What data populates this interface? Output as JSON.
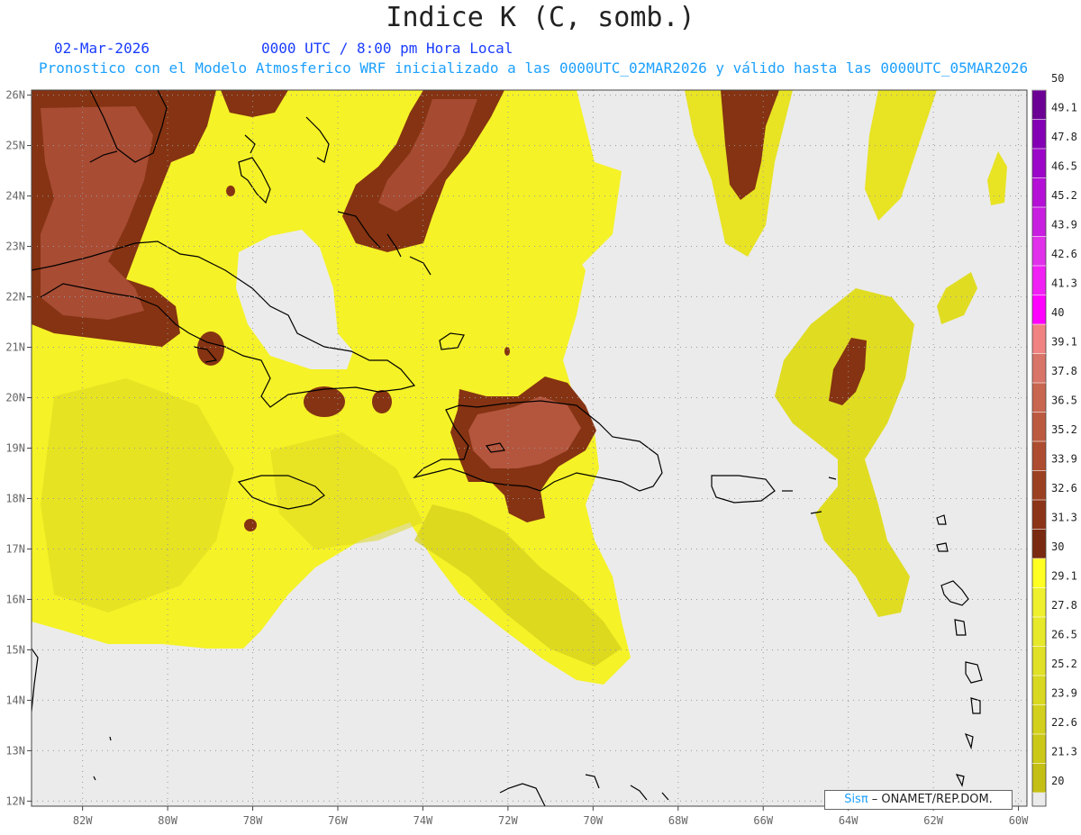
{
  "header": {
    "title": "Indice K (C, somb.)",
    "date": "02-Mar-2026",
    "time": "0000 UTC / 8:00 pm Hora Local",
    "description": "Pronostico con el Modelo Atmosferico WRF inicializado a las 0000UTC_02MAR2026 y válido hasta las  0000UTC_05MAR2026"
  },
  "map": {
    "lon_range": [
      -83.2,
      -59.8
    ],
    "lat_range": [
      11.9,
      26.1
    ],
    "lon_ticks": [
      "82W",
      "80W",
      "78W",
      "76W",
      "74W",
      "72W",
      "70W",
      "68W",
      "66W",
      "64W",
      "62W",
      "60W"
    ],
    "lat_ticks": [
      "12N",
      "13N",
      "14N",
      "15N",
      "16N",
      "17N",
      "18N",
      "19N",
      "20N",
      "21N",
      "22N",
      "23N",
      "24N",
      "25N",
      "26N"
    ],
    "grid": true,
    "background_color": "#ebebeb"
  },
  "colorbar": {
    "labels": [
      "20",
      "21.3",
      "22.6",
      "23.9",
      "25.2",
      "26.5",
      "27.8",
      "29.1",
      "30",
      "31.3",
      "32.6",
      "33.9",
      "35.2",
      "36.5",
      "37.8",
      "39.1",
      "40",
      "41.3",
      "42.6",
      "43.9",
      "45.2",
      "46.5",
      "47.8",
      "49.1",
      "50"
    ],
    "colors": [
      "#c4bf14",
      "#cbc818",
      "#d2d01c",
      "#d9d821",
      "#e0e026",
      "#e6e82a",
      "#eef02e",
      "#ffff22",
      "#7a2a10",
      "#8c3418",
      "#9c4022",
      "#ad4c30",
      "#bc5a40",
      "#c86650",
      "#d87468",
      "#f08282",
      "#ff00ff",
      "#f020f4",
      "#e030ea",
      "#c81ee0",
      "#b410d6",
      "#9c06c8",
      "#8400b4",
      "#6c0094",
      "#620070"
    ]
  },
  "credit": {
    "brand": "Sisπ",
    "text": " – ONAMET/REP.DOM."
  }
}
